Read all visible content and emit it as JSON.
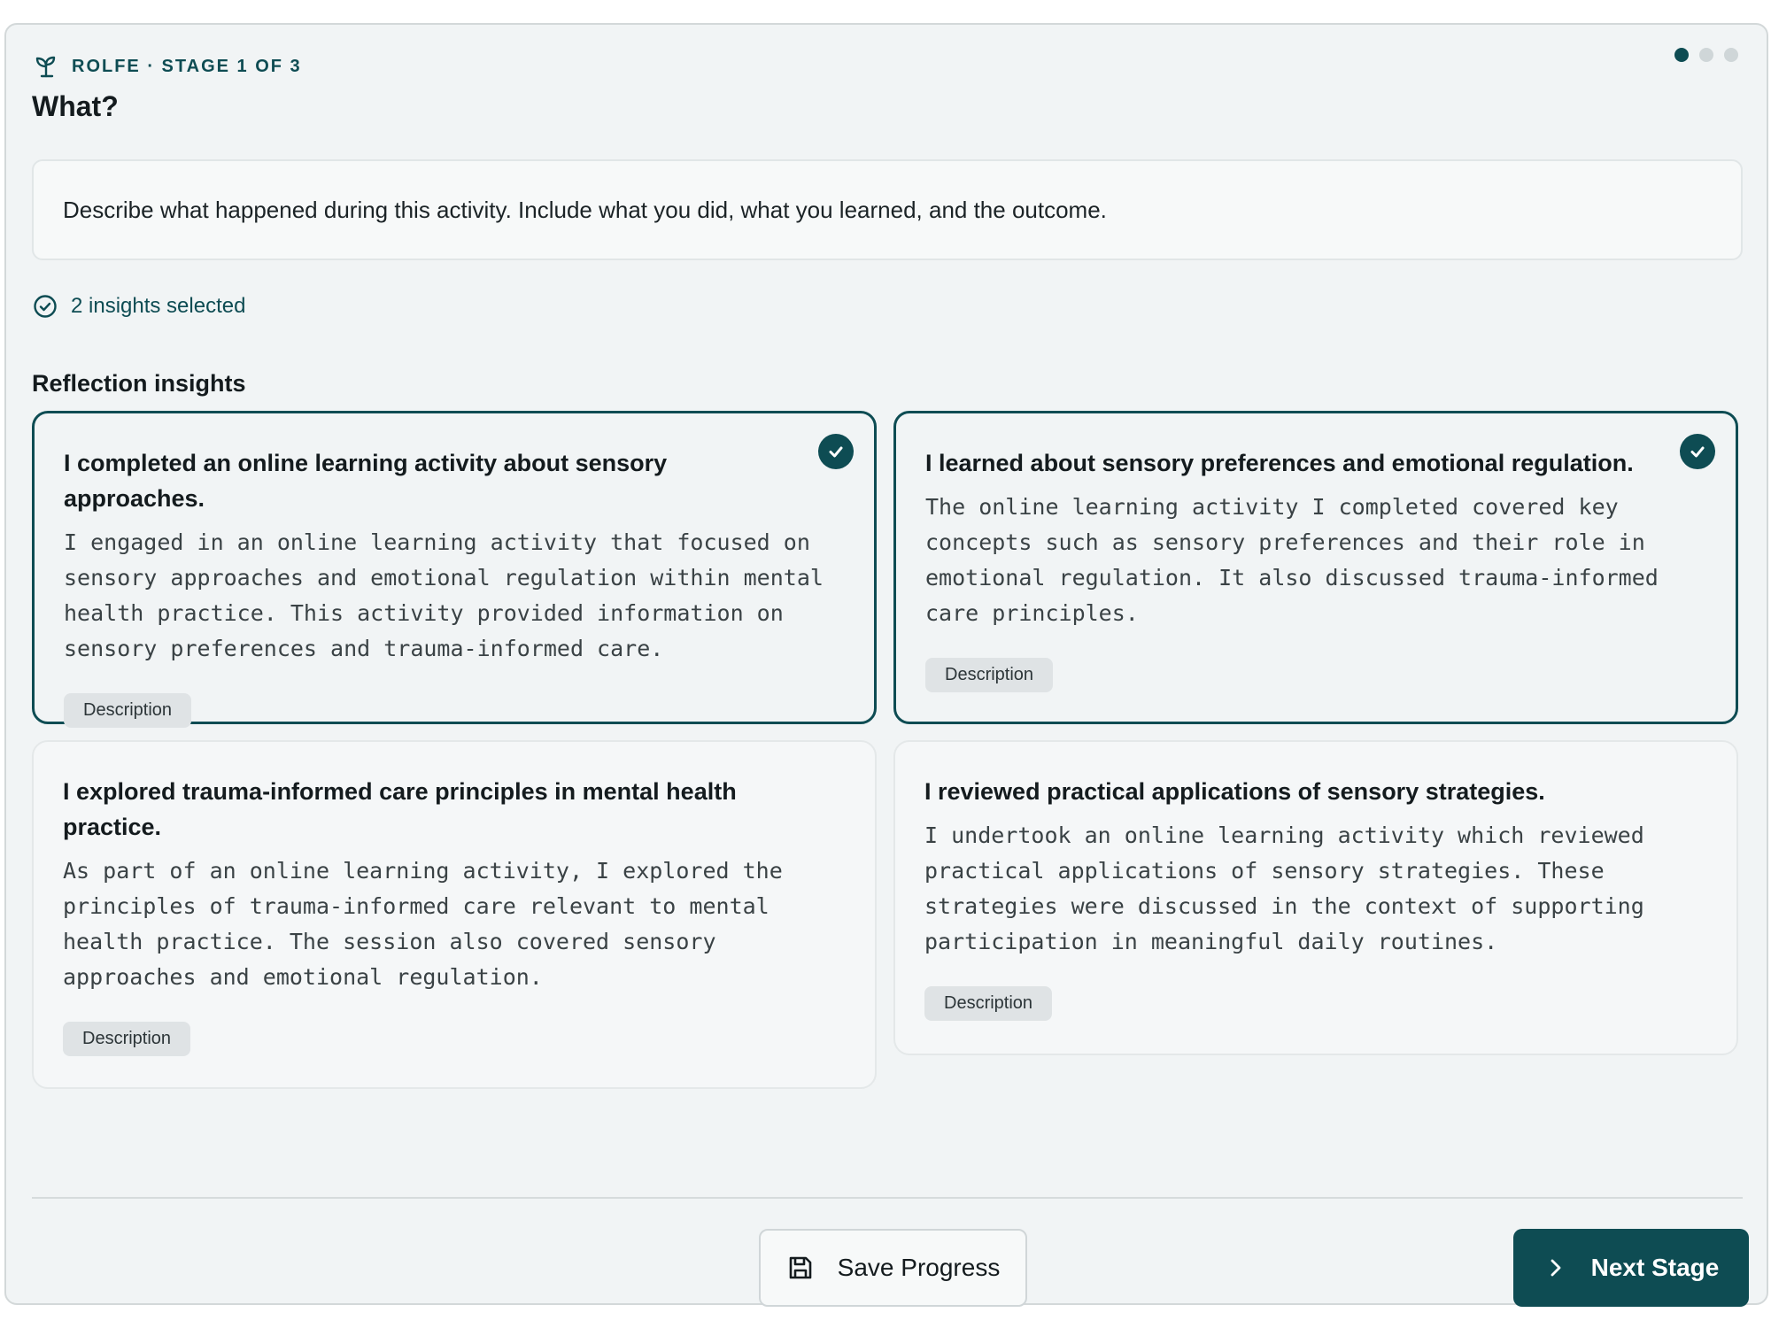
{
  "header": {
    "stage_label": "ROLFE · STAGE 1 OF 3",
    "stage_icon": "sprout-icon",
    "title": "What?",
    "progress": {
      "current": 1,
      "total": 3
    }
  },
  "prompt": {
    "text": "Describe what happened during this activity. Include what you did, what you learned, and the outcome."
  },
  "selection": {
    "text": "2 insights selected",
    "icon": "check-circle-icon"
  },
  "section": {
    "title": "Reflection insights"
  },
  "insights": [
    {
      "title": "I completed an online learning activity about sensory approaches.",
      "body": "I engaged in an online learning activity that focused on sensory approaches and emotional regulation within mental health practice. This activity provided information on sensory preferences and trauma-informed care.",
      "tag": "Description",
      "selected": true
    },
    {
      "title": "I learned about sensory preferences and emotional regulation.",
      "body": "The online learning activity I completed covered key concepts such as sensory preferences and their role in emotional regulation. It also discussed trauma-informed care principles.",
      "tag": "Description",
      "selected": true
    },
    {
      "title": "I explored trauma-informed care principles in mental health practice.",
      "body": "As part of an online learning activity, I explored the principles of trauma-informed care relevant to mental health practice. The session also covered sensory approaches and emotional regulation.",
      "tag": "Description",
      "selected": false
    },
    {
      "title": "I reviewed practical applications of sensory strategies.",
      "body": "I undertook an online learning activity which reviewed practical applications of sensory strategies. These strategies were discussed in the context of supporting participation in meaningful daily routines.",
      "tag": "Description",
      "selected": false
    }
  ],
  "footer": {
    "save_label": "Save Progress",
    "save_icon": "floppy-disk-icon",
    "next_label": "Next Stage",
    "next_icon": "chevron-right-icon"
  },
  "colors": {
    "accent": "#0e4c53",
    "panel_bg": "#f1f4f5",
    "tag_bg": "#dfe3e5"
  }
}
